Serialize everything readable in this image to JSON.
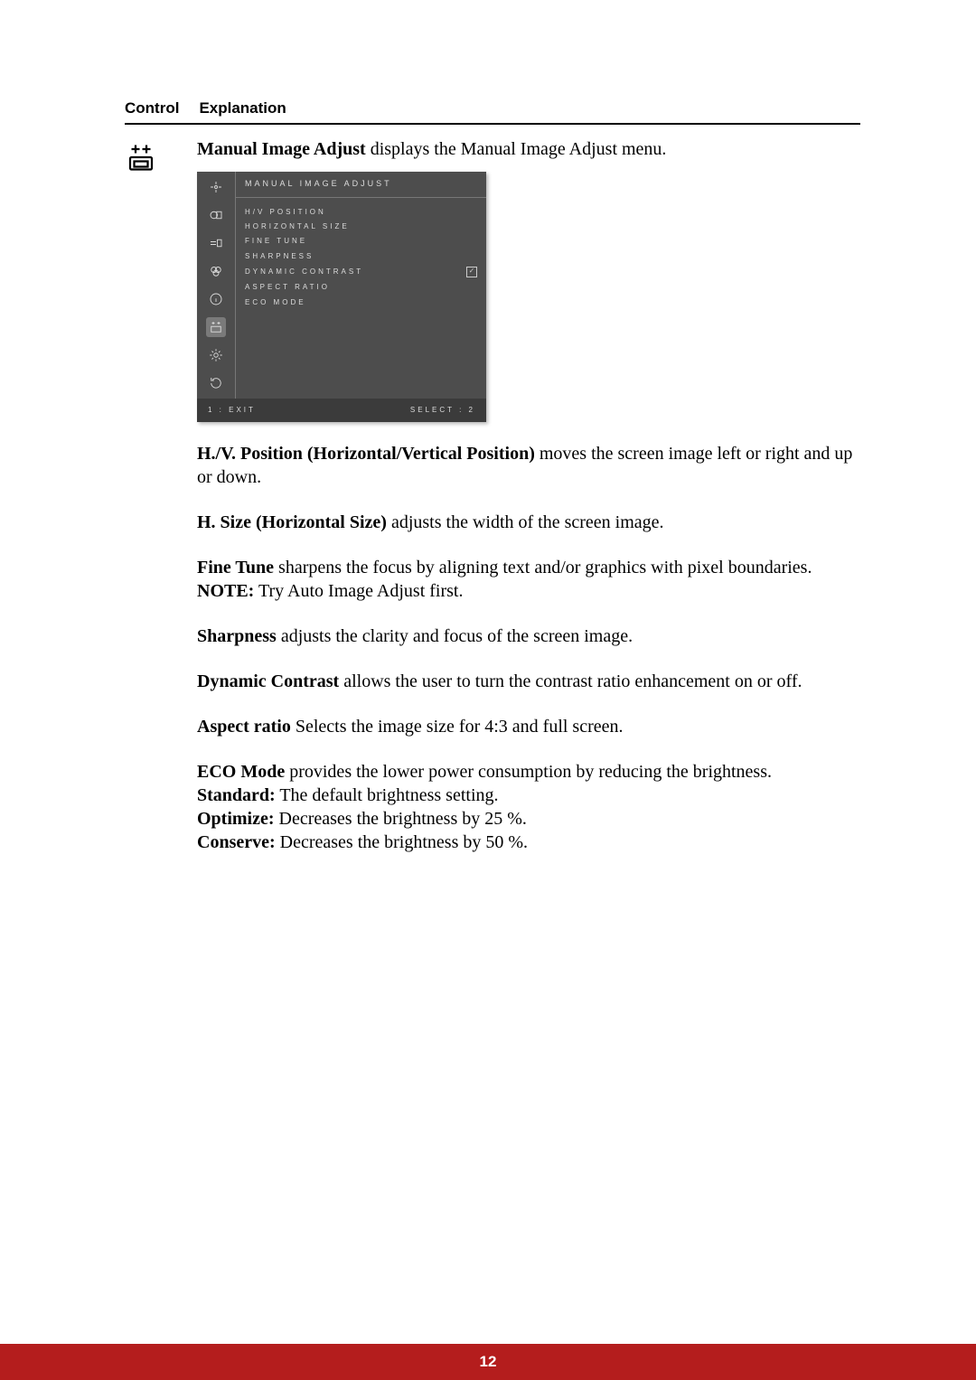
{
  "header": {
    "col1": "Control",
    "col2": "Explanation"
  },
  "intro": {
    "bold": "Manual Image Adjust",
    "rest": " displays the Manual Image Adjust menu."
  },
  "osd": {
    "title": "MANUAL IMAGE ADJUST",
    "items": [
      {
        "label": "H/V POSITION",
        "checked": false
      },
      {
        "label": "HORIZONTAL SIZE",
        "checked": false
      },
      {
        "label": "FINE TUNE",
        "checked": false
      },
      {
        "label": "SHARPNESS",
        "checked": false
      },
      {
        "label": "DYNAMIC CONTRAST",
        "checked": true
      },
      {
        "label": "ASPECT RATIO",
        "checked": false
      },
      {
        "label": "ECO MODE",
        "checked": false
      }
    ],
    "footer_left": "1 : EXIT",
    "footer_right": "SELECT : 2",
    "sidebar_icons": [
      "auto-adjust-icon",
      "contrast-icon",
      "input-select-icon",
      "color-adjust-icon",
      "information-icon",
      "manual-image-adjust-icon",
      "setup-menu-icon",
      "memory-recall-icon"
    ]
  },
  "definitions": {
    "hvpos_bold": "H./V. Position (Horizontal/Vertical Position)",
    "hvpos_rest": " moves the screen image left or right and up or down.",
    "hsize_bold": "H. Size (Horizontal Size)",
    "hsize_rest": " adjusts the width of the screen image.",
    "finetune_bold": "Fine Tune",
    "finetune_rest": " sharpens the focus by aligning text and/or graphics with pixel boundaries.",
    "note_bold": "NOTE:",
    "note_rest": " Try Auto Image Adjust first.",
    "sharp_bold": "Sharpness",
    "sharp_rest": " adjusts the clarity and focus of the screen image.",
    "dyncon_bold": "Dynamic Contrast",
    "dyncon_rest": " allows the user to turn the contrast ratio enhancement on or off.",
    "aspect_bold": "Aspect ratio",
    "aspect_rest": " Selects the image size for 4:3 and full screen.",
    "eco_bold": "ECO Mode",
    "eco_rest": " provides the lower power consumption by reducing the brightness.",
    "eco_std_bold": "Standard:",
    "eco_std_rest": " The default brightness setting.",
    "eco_opt_bold": "Optimize:",
    "eco_opt_rest": " Decreases the brightness by 25 %.",
    "eco_con_bold": "Conserve:",
    "eco_con_rest": " Decreases the brightness by 50 %."
  },
  "page_number": "12"
}
